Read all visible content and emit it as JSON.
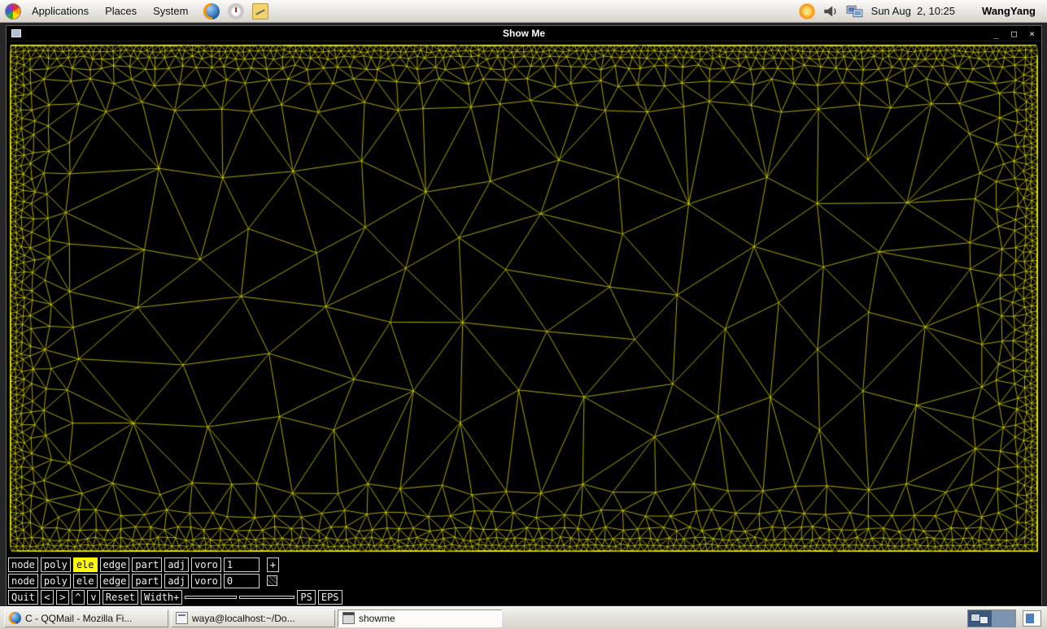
{
  "panel": {
    "menus": [
      "Applications",
      "Places",
      "System"
    ],
    "clock": "Sun Aug  2, 10:25",
    "user": "WangYang"
  },
  "window": {
    "title": "Show Me",
    "controls": {
      "minimize": "_",
      "maximize": "□",
      "close": "×"
    }
  },
  "showme": {
    "row1": {
      "buttons": [
        "node",
        "poly",
        "ele",
        "edge",
        "part",
        "adj",
        "voro"
      ],
      "active": "ele",
      "value": "1",
      "plus": "+"
    },
    "row2": {
      "buttons": [
        "node",
        "poly",
        "ele",
        "edge",
        "part",
        "adj",
        "voro"
      ],
      "value": "0"
    },
    "row3": {
      "quit": "Quit",
      "left": "<",
      "right": ">",
      "up": "^",
      "down": "v",
      "reset": "Reset",
      "width_plus": "Width+",
      "ps": "PS",
      "eps": "EPS"
    }
  },
  "mesh": {
    "background": "#000000",
    "stroke": "#f2ef00"
  },
  "taskbar": {
    "tasks": [
      {
        "label": "C - QQMail - Mozilla Fi..."
      },
      {
        "label": "waya@localhost:~/Do..."
      },
      {
        "label": "showme"
      }
    ]
  }
}
